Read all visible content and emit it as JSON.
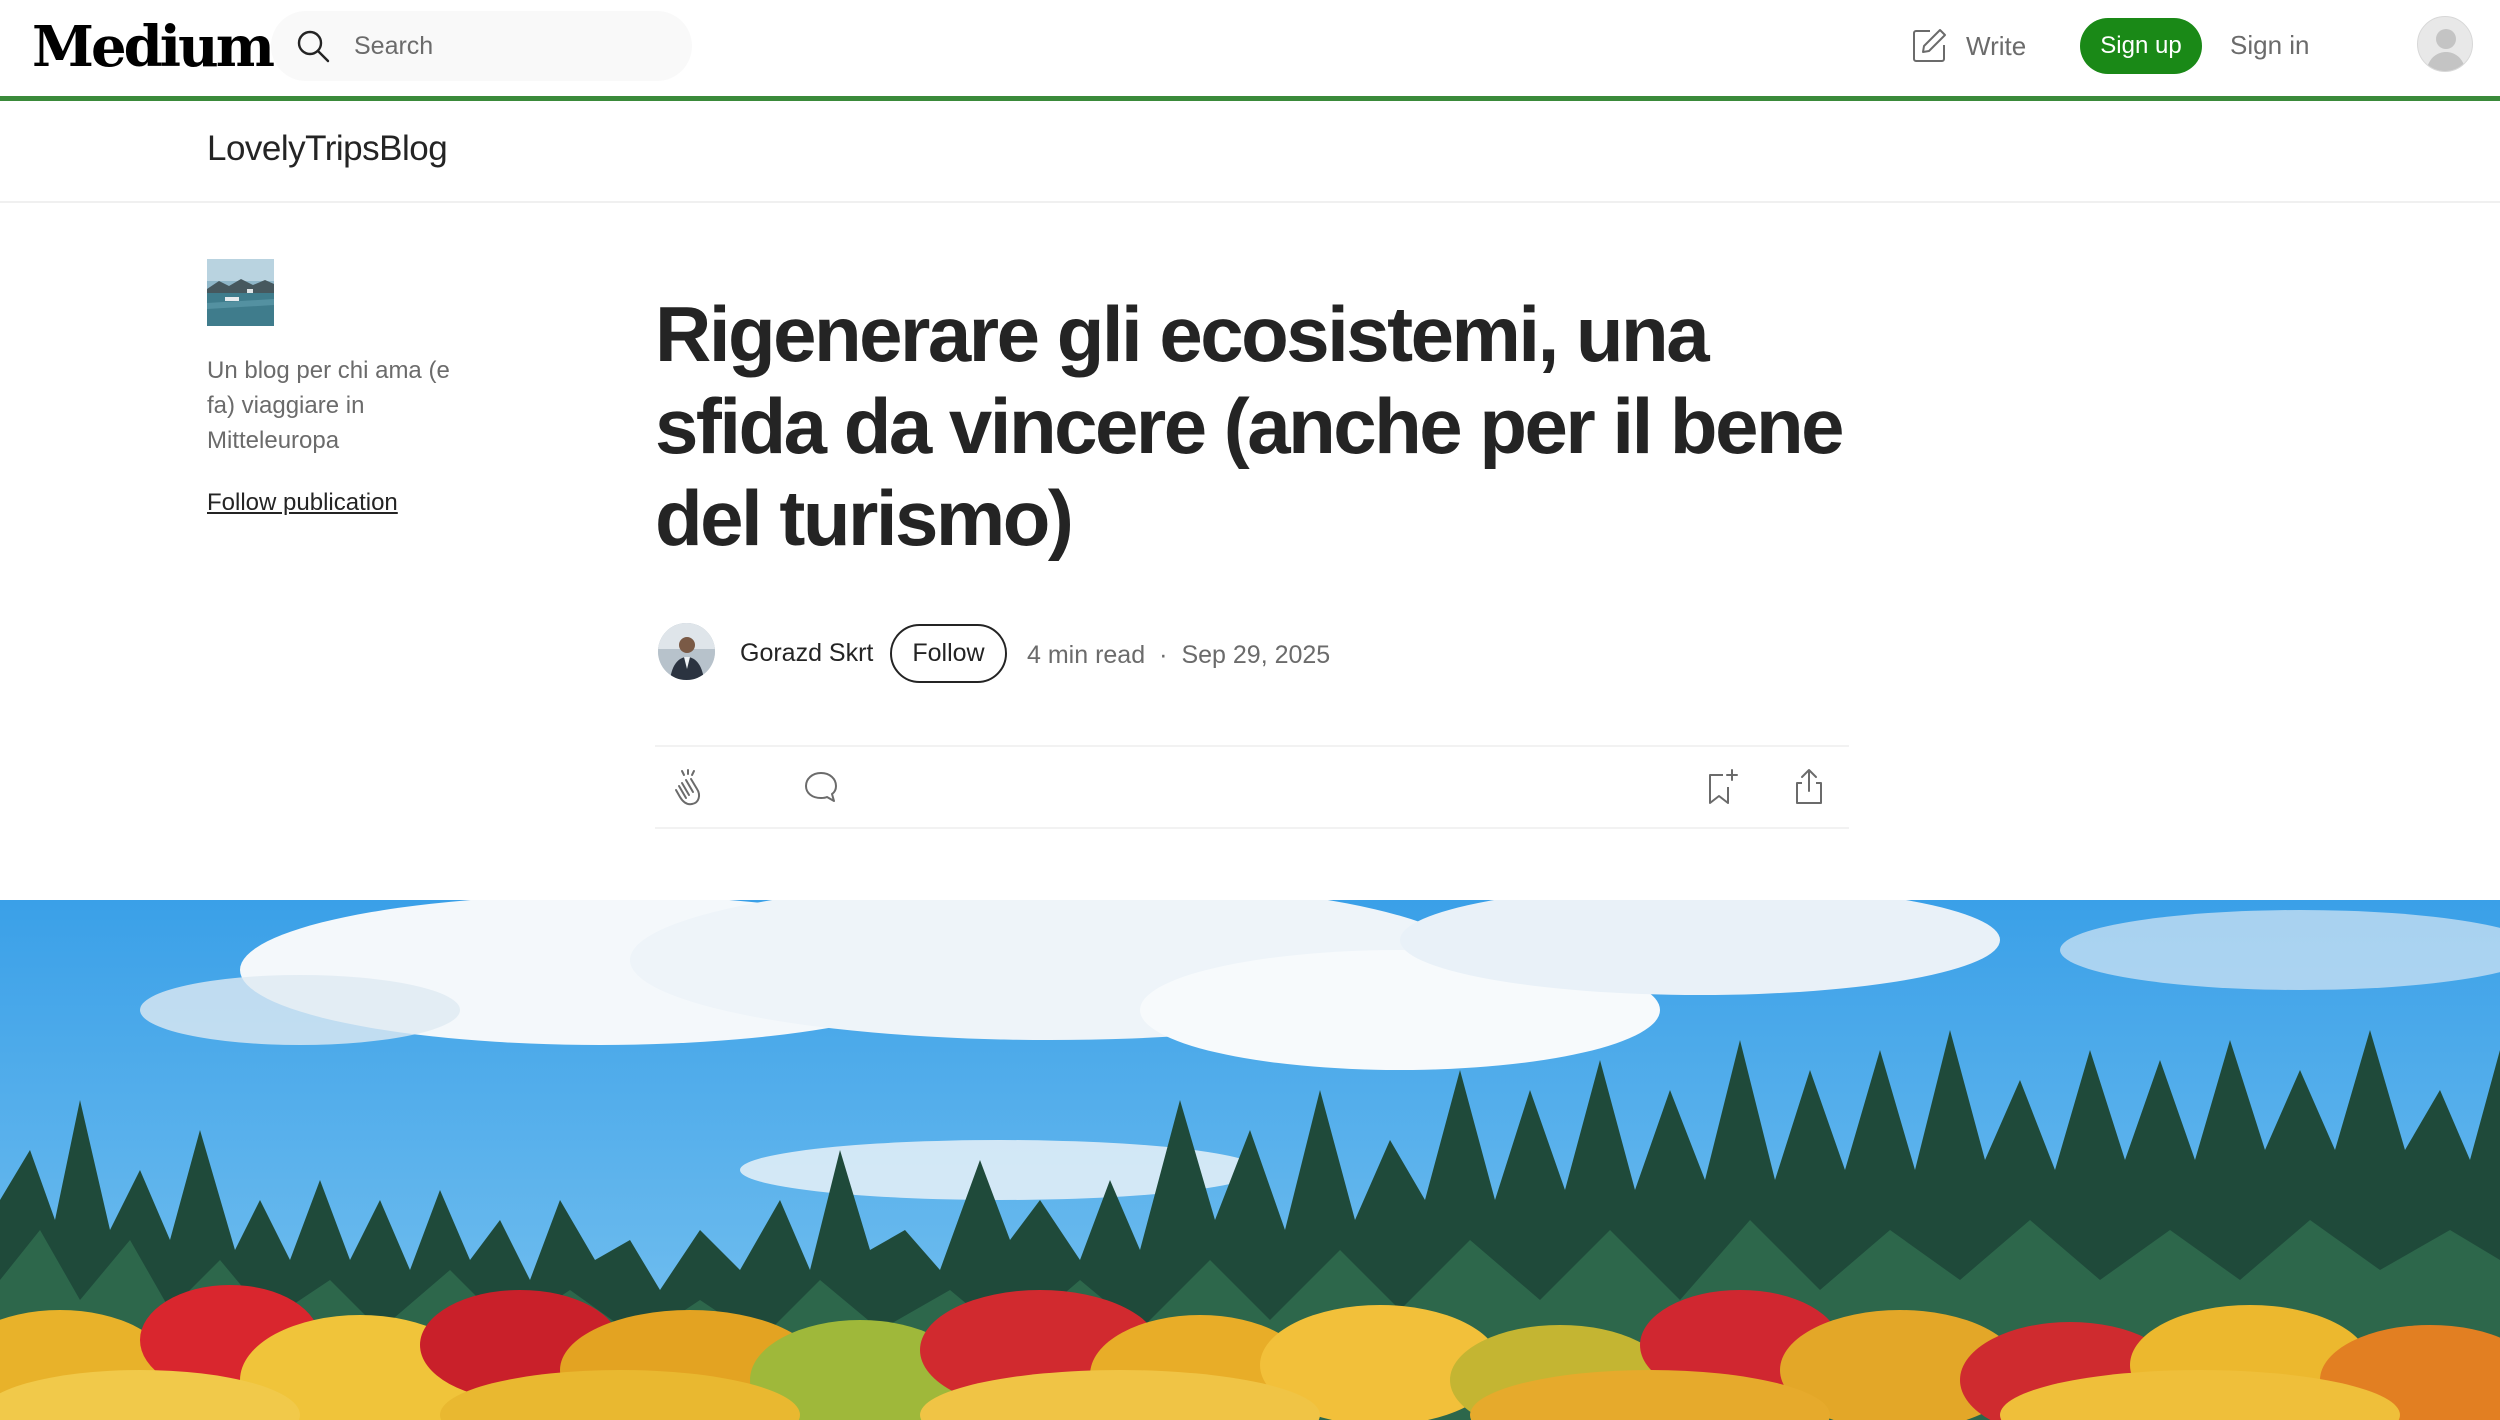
{
  "header": {
    "logo": "Medium",
    "search_placeholder": "Search",
    "write_label": "Write",
    "signup_label": "Sign up",
    "signin_label": "Sign in"
  },
  "publication": {
    "name": "LovelyTripsBlog",
    "description": "Un blog per chi ama (e fa) viaggiare in Mitteleuropa",
    "follow_label": "Follow publication"
  },
  "article": {
    "title": "Rigenerare gli ecosistemi, una sfida da vincere (anche per il bene del turismo)",
    "author": "Gorazd Skrt",
    "follow_label": "Follow",
    "read_time": "4 min read",
    "separator": "·",
    "date": "Sep 29, 2025"
  },
  "actions": {
    "clap_icon": "clap-icon",
    "comment_icon": "comment-icon",
    "bookmark_icon": "bookmark-add-icon",
    "share_icon": "share-icon"
  },
  "colors": {
    "accent_green": "#1a8917",
    "header_line": "#3a8a3a",
    "text_primary": "#242424",
    "text_secondary": "#6b6b6b"
  }
}
